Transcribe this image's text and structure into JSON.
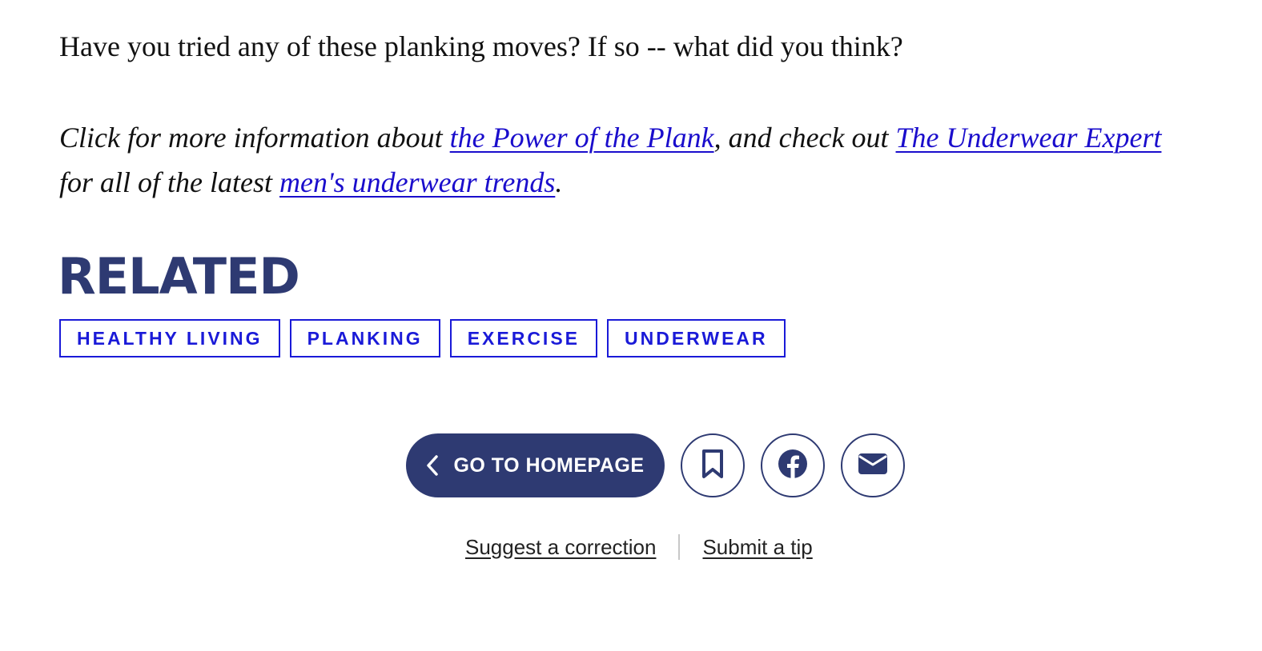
{
  "article": {
    "question": "Have you tried any of these planking moves? If so -- what did you think?",
    "info_text_1": "Click for more information about ",
    "link_power_plank": "the Power of the Plank",
    "info_text_2": ", and check out ",
    "link_underwear_expert": "The Underwear Expert",
    "info_text_3": " for all of the latest ",
    "link_underwear_trends": "men's underwear trends",
    "info_text_4": "."
  },
  "related": {
    "title": "RELATED",
    "tags": [
      "HEALTHY LIVING",
      "PLANKING",
      "EXERCISE",
      "UNDERWEAR"
    ]
  },
  "actions": {
    "homepage_label": "GO TO HOMEPAGE",
    "icons": [
      "chevron-left-icon",
      "bookmark-icon",
      "facebook-icon",
      "email-icon"
    ]
  },
  "footer": {
    "suggest_correction": "Suggest a correction",
    "submit_tip": "Submit a tip"
  },
  "colors": {
    "brand_navy": "#2e3a72",
    "tag_blue": "#1a1ad8",
    "link_blue": "#1a0dcc"
  }
}
